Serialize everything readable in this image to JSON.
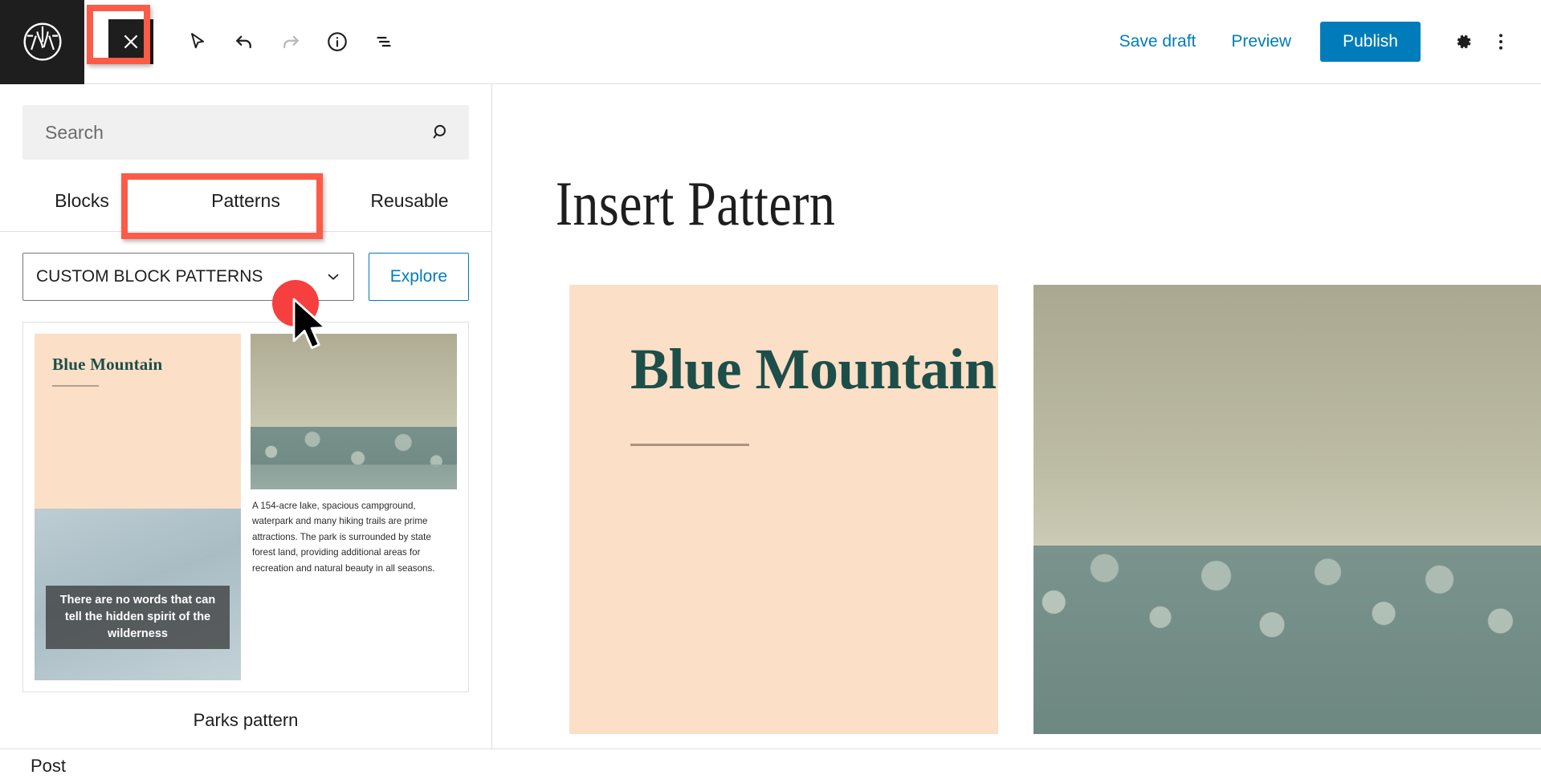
{
  "app": {
    "name": "WordPress Block Editor"
  },
  "toolbar": {
    "logo_icon": "wordpress-logo-icon",
    "close_label": "×",
    "close_icon": "close-x-icon",
    "tools": [
      {
        "icon": "select-cursor-icon",
        "label": "Tools",
        "disabled": false
      },
      {
        "icon": "undo-arrow-icon",
        "label": "Undo",
        "disabled": false
      },
      {
        "icon": "redo-arrow-icon",
        "label": "Redo",
        "disabled": true
      },
      {
        "icon": "info-circle-icon",
        "label": "Details",
        "disabled": false
      },
      {
        "icon": "list-view-icon",
        "label": "List view",
        "disabled": false
      }
    ],
    "save_draft_label": "Save draft",
    "preview_label": "Preview",
    "publish_label": "Publish",
    "settings_icon": "gear-icon",
    "more_icon": "three-dots-vertical-icon",
    "accent_color": "#007cba"
  },
  "sidebar": {
    "search": {
      "placeholder": "Search",
      "value": "",
      "icon": "search-magnifier-icon"
    },
    "tabs": [
      {
        "label": "Blocks",
        "active": false
      },
      {
        "label": "Patterns",
        "active": true
      },
      {
        "label": "Reusable",
        "active": false
      }
    ],
    "category_select": {
      "value": "CUSTOM BLOCK PATTERNS",
      "chevron_icon": "chevron-down-icon"
    },
    "explore_label": "Explore",
    "patterns": [
      {
        "label": "Parks pattern",
        "heading": "Blue Mountain",
        "body": "A 154-acre lake, spacious campground, waterpark and many hiking trails are prime attractions. The park is surrounded by state forest land, providing additional areas for recreation and natural beauty in all seasons.",
        "quote": "There are no words that can tell the hidden spirit of the wilderness"
      }
    ]
  },
  "canvas": {
    "title": "Insert Pattern",
    "block_heading": "Blue Mountain"
  },
  "bottombar": {
    "breadcrumb": "Post"
  },
  "annotations": {
    "highlight_color": "#fb5b47",
    "click_dot_color": "#f5403f",
    "highlighted_elements": [
      "close-button",
      "patterns-tab"
    ],
    "cursor_target": "category-select"
  },
  "colors": {
    "peach": "#fbdfc6",
    "teal": "#1d4e4a",
    "blue": "#007cba",
    "dark": "#1e1e1e"
  }
}
